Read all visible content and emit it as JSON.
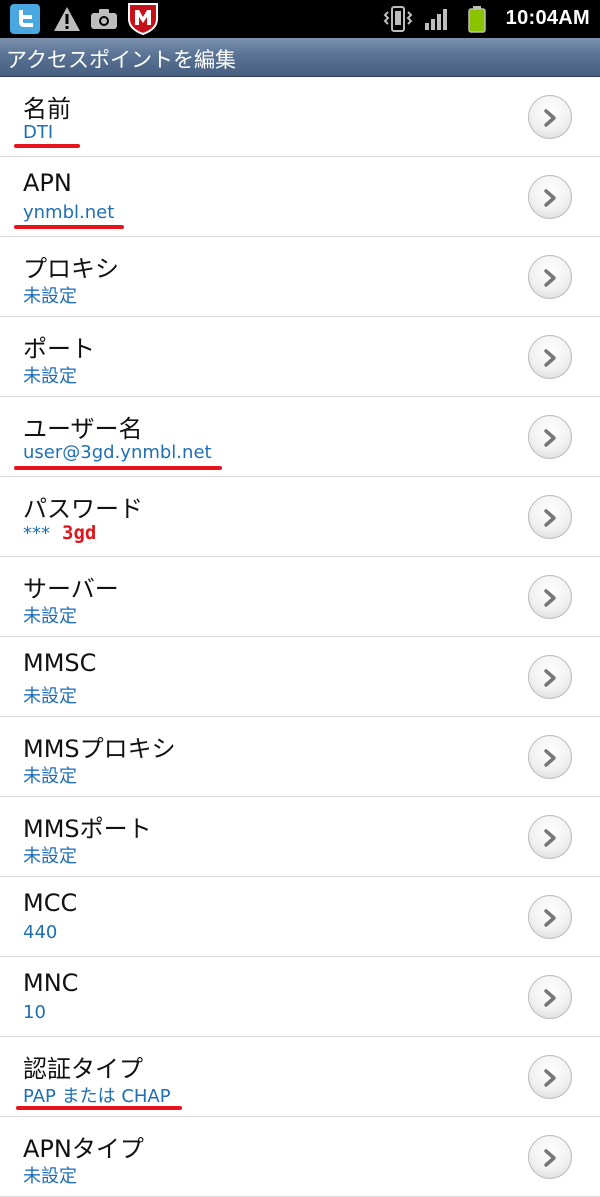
{
  "status_bar": {
    "time": "10:04AM",
    "icons": [
      "twitter-icon",
      "warning-icon",
      "camera-icon",
      "mcafee-icon",
      "vibrate-icon",
      "signal-icon",
      "battery-icon"
    ],
    "battery_color": "#8ac400"
  },
  "title_bar": {
    "title": "アクセスポイントを編集"
  },
  "items": [
    {
      "label": "名前",
      "value": "DTI"
    },
    {
      "label": "APN",
      "value": "ynmbl.net"
    },
    {
      "label": "プロキシ",
      "value": "未設定"
    },
    {
      "label": "ポート",
      "value": "未設定"
    },
    {
      "label": "ユーザー名",
      "value": "user@3gd.ynmbl.net"
    },
    {
      "label": "パスワード",
      "value": "***",
      "note": "3gd"
    },
    {
      "label": "サーバー",
      "value": "未設定"
    },
    {
      "label": "MMSC",
      "value": "未設定"
    },
    {
      "label": "MMSプロキシ",
      "value": "未設定"
    },
    {
      "label": "MMSポート",
      "value": "未設定"
    },
    {
      "label": "MCC",
      "value": "440"
    },
    {
      "label": "MNC",
      "value": "10"
    },
    {
      "label": "認証タイプ",
      "value": "PAP または CHAP"
    },
    {
      "label": "APNタイプ",
      "value": "未設定"
    }
  ],
  "colors": {
    "value_text": "#1f6fb5",
    "annotation_red": "#e8141d",
    "title_bar": "#5a7394"
  }
}
